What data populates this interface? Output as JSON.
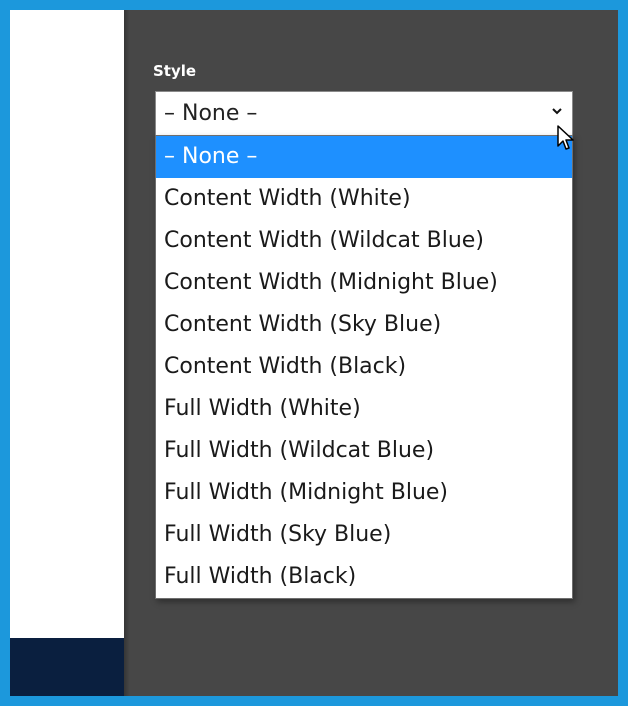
{
  "form": {
    "style_label": "Style",
    "style_select": {
      "value": "– None –",
      "options": [
        "– None –",
        "Content Width (White)",
        "Content Width (Wildcat Blue)",
        "Content Width (Midnight Blue)",
        "Content Width (Sky Blue)",
        "Content Width (Black)",
        "Full Width (White)",
        "Full Width (Wildcat Blue)",
        "Full Width (Midnight Blue)",
        "Full Width (Sky Blue)",
        "Full Width (Black)"
      ],
      "highlighted_index": 0
    }
  },
  "colors": {
    "frame_border": "#1c98dc",
    "panel_bg": "#474747",
    "navy_block": "#0a1f3f",
    "highlight": "#1e90ff"
  },
  "icons": {
    "select_arrow": "chevron-down-icon",
    "pointer": "mouse-pointer-icon"
  }
}
